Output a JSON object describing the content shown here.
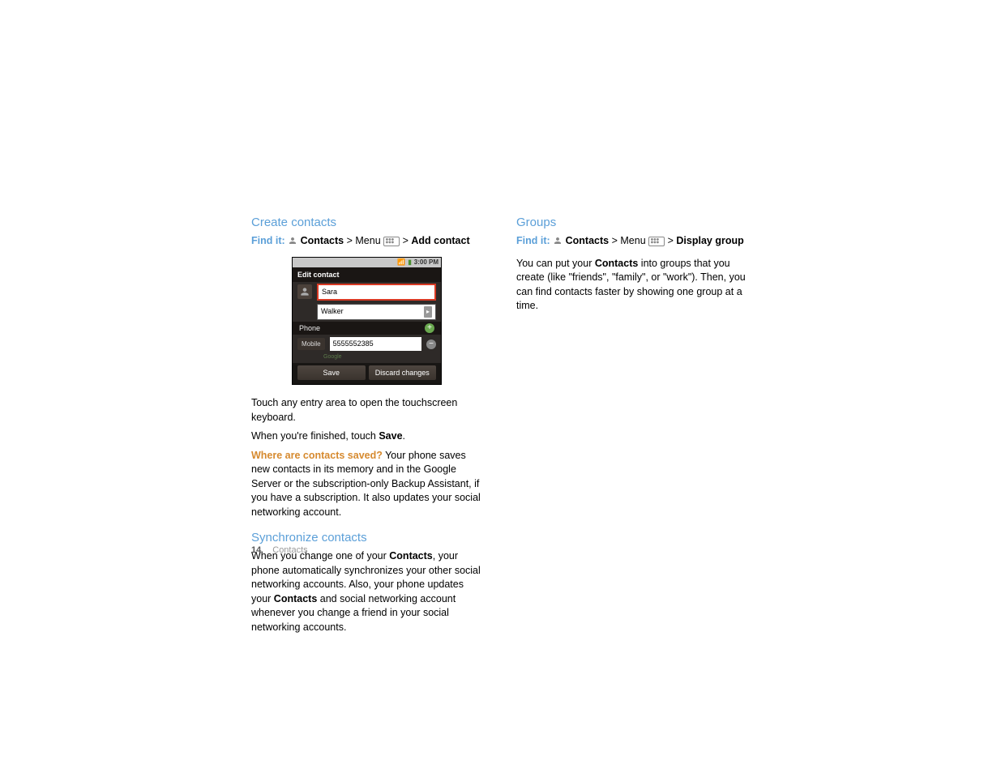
{
  "left": {
    "section1_title": "Create contacts",
    "find_it": {
      "label": "Find it:",
      "contacts": "Contacts",
      "sep1": " > ",
      "menu": "Menu ",
      "sep2": " > ",
      "action": "Add contact"
    },
    "screenshot": {
      "time": "3:00 PM",
      "header": "Edit contact",
      "first_name": "Sara",
      "last_name": "Walker",
      "phone_section": "Phone",
      "mobile_label": "Mobile",
      "phone_value": "5555552385",
      "sublabel": "Google",
      "save_btn": "Save",
      "discard_btn": "Discard changes"
    },
    "p1": "Touch any entry area to open the touchscreen keyboard.",
    "p2_prefix": "When you're finished, touch ",
    "p2_bold": "Save",
    "p2_suffix": ".",
    "p3_question": "Where are contacts saved?",
    "p3_rest": " Your phone saves new contacts in its memory and in the Google Server or the subscription-only Backup Assistant, if you have a subscription. It also updates your social networking account.",
    "section2_title": "Synchronize contacts",
    "p4_prefix": "When you change one of your ",
    "p4_bold1": "Contacts",
    "p4_mid": ", your phone automatically synchronizes your other social networking accounts. Also, your phone updates your ",
    "p4_bold2": "Contacts",
    "p4_suffix": " and social networking account whenever you change a friend in your social networking accounts."
  },
  "right": {
    "section1_title": "Groups",
    "find_it": {
      "label": "Find it:",
      "contacts": "Contacts",
      "sep1": " > ",
      "menu": "Menu ",
      "sep2": " > ",
      "action": "Display group"
    },
    "p1_prefix": "You can put your ",
    "p1_bold": "Contacts",
    "p1_suffix": " into groups that you create (like \"friends\", \"family\", or \"work\"). Then, you can find contacts faster by showing one group at a time."
  },
  "footer": {
    "page_number": "14",
    "section": "Contacts"
  }
}
